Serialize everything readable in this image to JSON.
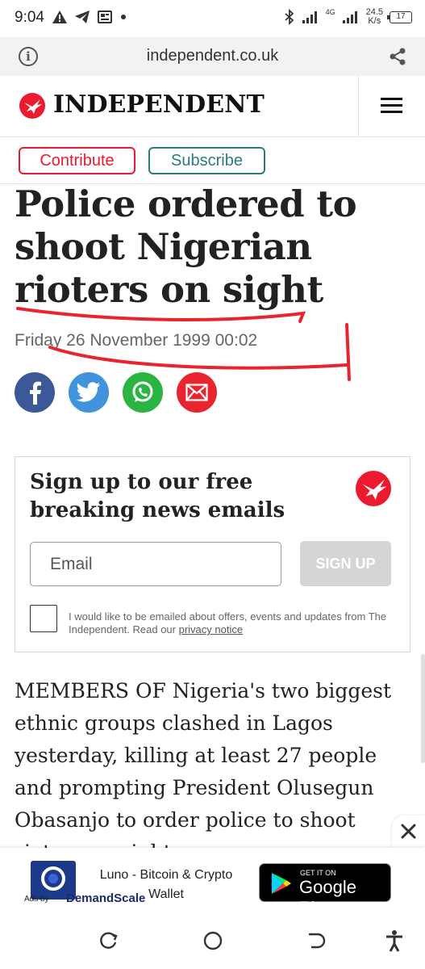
{
  "status_bar": {
    "time": "9:04",
    "network": "4G",
    "speed_value": "24.5",
    "speed_unit": "K/s",
    "battery": "17"
  },
  "browser": {
    "url": "independent.co.uk",
    "icons": [
      "info-icon",
      "share-icon"
    ]
  },
  "site": {
    "logo_text": "INDEPENDENT",
    "brand_color": "#ec1a2e",
    "contribute_label": "Contribute",
    "subscribe_label": "Subscribe"
  },
  "article": {
    "headline": "Police ordered to shoot Nigerian rioters on sight",
    "date": "Friday 26 November 1999 00:02",
    "share_icons": [
      "facebook-icon",
      "twitter-icon",
      "whatsapp-icon",
      "email-icon"
    ],
    "body": "MEMBERS OF Nigeria's two biggest ethnic groups clashed in Lagos yesterday, killing at least 27 people and prompting President Olusegun Obasanjo to order police to shoot rioters on sight."
  },
  "newsletter": {
    "title": "Sign up to our free breaking news emails",
    "email_placeholder": "Email",
    "signup_label": "SIGN UP",
    "consent_text": "I would like to be emailed about offers, events and updates from The Independent. Read our ",
    "privacy_link": "privacy notice"
  },
  "ad": {
    "app_title": "Luno - Bitcoin & Crypto Wallet",
    "store_small": "GET IT ON",
    "store_big": "Google Play",
    "ads_by": "Ads by",
    "network": "DemandScale"
  }
}
